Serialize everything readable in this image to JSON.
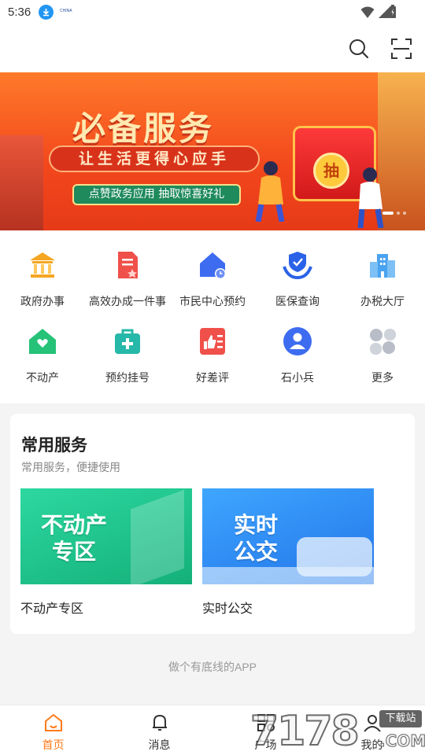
{
  "status_bar": {
    "time": "5:36",
    "mini_label": "CHINA"
  },
  "banner": {
    "title": "必备服务",
    "slogan": "让生活更得心应手",
    "pill_text": "点赞政务应用 抽取惊喜好礼",
    "coin_text": "抽"
  },
  "services": [
    {
      "label": "政府办事",
      "icon": "government-building-icon",
      "color": "#f5a623"
    },
    {
      "label": "高效办成一件事",
      "icon": "document-star-icon",
      "color": "#f0504a"
    },
    {
      "label": "市民中心预约",
      "icon": "house-clock-icon",
      "color": "#3d6cf0"
    },
    {
      "label": "医保查询",
      "icon": "shield-hands-icon",
      "color": "#2a62e8"
    },
    {
      "label": "办税大厅",
      "icon": "buildings-icon",
      "color": "#4aa3f0"
    },
    {
      "label": "不动产",
      "icon": "house-heart-icon",
      "color": "#25c277"
    },
    {
      "label": "预约挂号",
      "icon": "medical-bag-icon",
      "color": "#26b8a8"
    },
    {
      "label": "好差评",
      "icon": "thumbs-review-icon",
      "color": "#f0504a"
    },
    {
      "label": "石小兵",
      "icon": "person-badge-icon",
      "color": "#3d6cf0"
    },
    {
      "label": "更多",
      "icon": "more-grid-icon",
      "color": "#b8bdc7"
    }
  ],
  "common": {
    "title": "常用服务",
    "subtitle": "常用服务，便捷使用",
    "tiles": [
      {
        "image_text": "不动产\n专区",
        "label": "不动产专区"
      },
      {
        "image_text": "实时\n公交",
        "label": "实时公交"
      }
    ]
  },
  "footer_slogan": "做个有底线的APP",
  "bottom_nav": [
    {
      "label": "首页",
      "icon": "home-icon",
      "active": true
    },
    {
      "label": "消息",
      "icon": "bell-icon",
      "active": false
    },
    {
      "label": "广场",
      "icon": "plaza-icon",
      "active": false
    },
    {
      "label": "我的",
      "icon": "profile-icon",
      "active": false
    }
  ],
  "watermark": {
    "digits": "7178",
    "badge": "下载站",
    "domain": ".COM"
  },
  "colors": {
    "accent": "#ff7a1a",
    "banner": "#f2471c"
  }
}
